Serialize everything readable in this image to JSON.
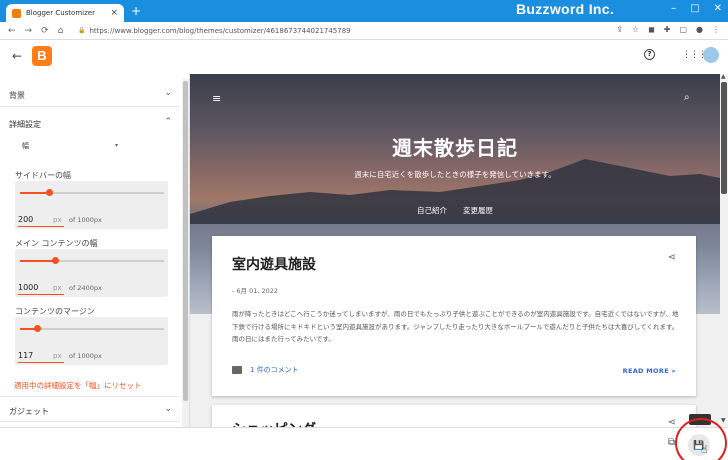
{
  "browser": {
    "tab_title": "Blogger Customizer",
    "tab_close": "×",
    "new_tab": "+",
    "brand": "Buzzword Inc.",
    "window_buttons": [
      "–",
      "□",
      "✕"
    ],
    "url": "https://www.blogger.com/blog/themes/customizer/4618673744021745789",
    "nav_icons": [
      "←",
      "→",
      "⟳",
      "⌂"
    ],
    "ext_icons": [
      "⇪",
      "☆",
      "◼",
      "✚",
      "▢",
      "●",
      "⋮"
    ],
    "lock": "🔒"
  },
  "header": {
    "back": "←",
    "logo": "B",
    "help": "?",
    "apps": "⋮⋮⋮"
  },
  "panel": {
    "sections": [
      {
        "label": "背景",
        "chevron": "⌄"
      },
      {
        "label": "詳細設定",
        "chevron": "⌃"
      }
    ],
    "select_value": "幅",
    "select_arrow": "▾",
    "sliders": [
      {
        "label": "サイドバーの幅",
        "value": "200",
        "unit": "px",
        "max": "of 1000px",
        "fraction": 0.2
      },
      {
        "label": "メイン コンテンツの幅",
        "value": "1000",
        "unit": "px",
        "max": "of 2400px",
        "fraction": 0.24
      },
      {
        "label": "コンテンツのマージン",
        "value": "117",
        "unit": "px",
        "max": "of 1000px",
        "fraction": 0.12
      }
    ],
    "reset_link": "適用中の詳細設定を「幅」にリセット",
    "gadget_label": "ガジェット",
    "gadget_chevron": "⌄"
  },
  "preview": {
    "menu": "≡",
    "search": "⌕",
    "title": "週末散歩日記",
    "description": "週末に自宅近くを散歩したときの様子を発信していきます。",
    "nav": [
      "自己紹介",
      "変更履歴"
    ],
    "post1": {
      "title": "室内遊具施設",
      "share": "⋖",
      "date": "- 6月 01, 2022",
      "body": "雨が降ったときはどこへ行こうか迷ってしまいますが、雨の日でもたっぷり子供と遊ぶことができるのが室内遊具施設です。自宅近くではないですが、地下鉄で行ける場所にキドキドという室内遊具施設があります。ジャンプしたり走ったり大きなボールプールで遊んだりと子供たちは大喜びしてくれます。雨の日にはまた行ってみたいです。",
      "comment": "1 件のコメント",
      "readmore": "READ MORE »"
    },
    "post2": {
      "title": "ショッピング"
    }
  },
  "bottom": {
    "devices": "⧉",
    "save": "💾",
    "cursor": "☝"
  }
}
